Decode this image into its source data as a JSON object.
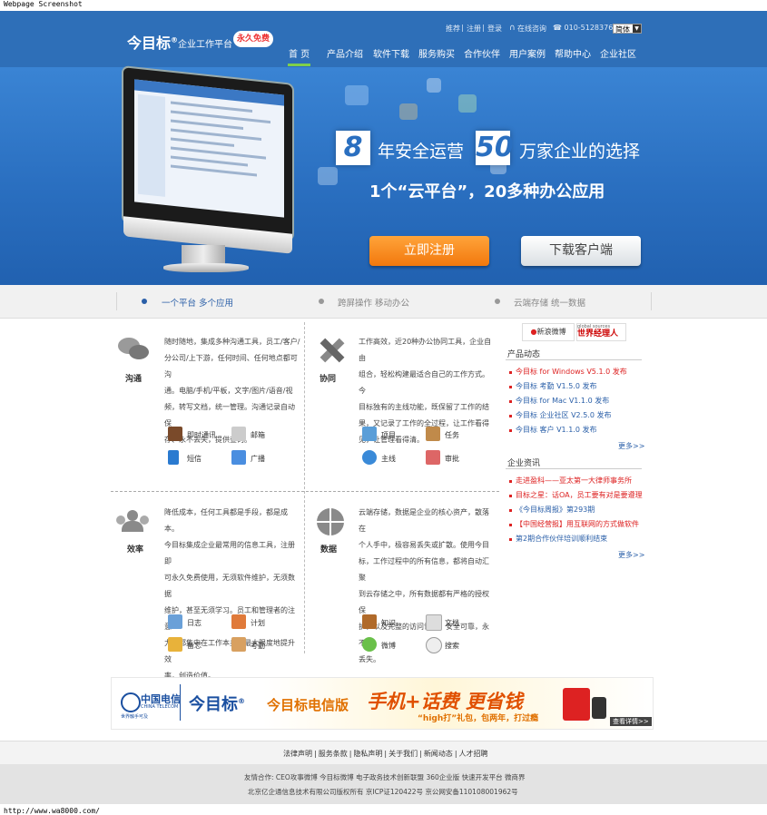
{
  "caption": "Webpage Screenshot",
  "footer_url": "http://www.wa8000.com/",
  "header": {
    "logo": "今目标",
    "logo_reg": "®",
    "logo_sub": "企业工作平台",
    "logo_badge": "永久免费",
    "top_links": [
      "推荐",
      "注册",
      "登录"
    ],
    "separator": "|",
    "online_consult": "在线咨询",
    "phone": "☎ 010-51283768",
    "lang": "简体",
    "nav": [
      "首 页",
      "产品介绍",
      "软件下载",
      "服务购买",
      "合作伙伴",
      "用户案例",
      "帮助中心",
      "企业社区"
    ]
  },
  "hero": {
    "num1": "8",
    "text1": "年安全运营",
    "num2": "50",
    "text2": "万家企业的选择",
    "line2": "1个“云平台”，20多种办公应用",
    "btn_register": "立即注册",
    "btn_download": "下载客户端"
  },
  "strip": [
    "一个平台  多个应用",
    "跨屏操作  移动办公",
    "云端存储  统一数据"
  ],
  "blocks": [
    {
      "title": "沟通",
      "text": [
        "随时随地，集成多种沟通工具，员工/客户/",
        "分公司/上下游，任何时间、任何地点都可沟",
        "通。电脑/手机/平板，文字/图片/语音/视",
        "频，转写文档，统一管理。沟通记录自动保",
        "存、永不丢失，提供查询。"
      ],
      "apps": [
        "即时通讯",
        "邮箱",
        "短信",
        "广播"
      ]
    },
    {
      "title": "协同",
      "text": [
        "工作高效，近20种办公协同工具，企业自由",
        "组合，轻松构建最适合自己的工作方式。今",
        "目标独有的主线功能，既保留了工作的结",
        "果，又记录了工作的全过程，让工作看得",
        "见，让管理看得清。"
      ],
      "apps": [
        "项目",
        "任务",
        "主线",
        "审批"
      ]
    },
    {
      "title": "效率",
      "text": [
        "降低成本，任何工具都是手段，都是成本。",
        "今目标集成企业最常用的信息工具，注册即",
        "可永久免费使用，无须软件维护，无须数据",
        "维护，甚至无须学习。员工和管理者的注意",
        "力，都集中在工作本身，最大限度地提升效",
        "率，创造价值。"
      ],
      "apps": [
        "日志",
        "计划",
        "备忘",
        "考勤"
      ]
    },
    {
      "title": "数据",
      "text": [
        "云端存储，数据是企业的核心资产，散落在",
        "个人手中，极容易丢失或扩散。使用今目",
        "标，工作过程中的所有信息，都将自动汇聚",
        "到云存储之中，所有数据都有严格的授权保",
        "护，以及完整的访问记录。安全可靠，永不",
        "丢失。"
      ],
      "apps": [
        "知识",
        "文档",
        "微博",
        "搜索"
      ]
    }
  ],
  "sidebar": {
    "logos": [
      "新浪微博",
      "世界经理人"
    ],
    "logo_small": "global sources",
    "news_title": "产品动态",
    "news": [
      "今目标 for Windows V5.1.0 发布",
      "今目标 考勤 V1.5.0 发布",
      "今目标 for Mac V1.1.0 发布",
      "今目标 企业社区 V2.5.0 发布",
      "今目标 客户 V1.1.0 发布"
    ],
    "more": "更多>>",
    "info_title": "企业资讯",
    "info": [
      "走进盈科——亚太第一大律师事务所",
      "目标之星：话OA，员工要有对是要遵理",
      "《今目标周报》第293期",
      "【中国经营报】用互联网的方式做软件",
      "第2期合作伙伴培训顺利结束"
    ]
  },
  "banner": {
    "telecom": "中国电信",
    "telecom_en": "CHINA TELECOM",
    "telecom_sub": "世界触手可及",
    "brand": "今目标",
    "brand_reg": "®",
    "title": "今目标电信版",
    "slogan": "手机+话费  更省钱",
    "sub": "“high打”礼包，包两年，打过瘾",
    "view_detail": "查看详情>>"
  },
  "footer": {
    "links": [
      "法律声明",
      "服务条款",
      "隐私声明",
      "关于我们",
      "新闻动态",
      "人才招聘"
    ],
    "friends": "友情合作: CEO攻事微博  今目标微博  电子政务技术创新联盟  360企业版  快速开发平台  微商界",
    "copyright": "北京亿企通信息技术有限公司版权所有 京ICP证120422号 京公网安备110108001962号"
  },
  "colors": {
    "header_blue": "#2e6fb8",
    "orange": "#f58a1f",
    "nav_active": "#7fd04a",
    "news_red": "#d22",
    "news_blue": "#2a5fa8"
  }
}
